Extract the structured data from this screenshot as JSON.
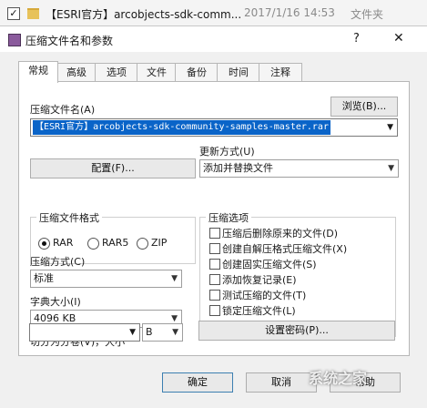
{
  "explorer": {
    "filename": "【ESRI官方】arcobjects-sdk-comm...",
    "date": "2017/1/16 14:53",
    "type": "文件夹"
  },
  "dialog": {
    "title": "压缩文件名和参数",
    "help": "?",
    "close": "✕",
    "tabs": [
      "常规",
      "高级",
      "选项",
      "文件",
      "备份",
      "时间",
      "注释"
    ],
    "archive_label": "压缩文件名(A)",
    "browse": "浏览(B)...",
    "archive_value": "【ESRI官方】arcobjects-sdk-community-samples-master.rar",
    "update_mode_label": "更新方式(U)",
    "profiles": "配置(F)...",
    "update_mode_value": "添加并替换文件",
    "format_group": "压缩文件格式",
    "formats": [
      "RAR",
      "RAR5",
      "ZIP"
    ],
    "options_group": "压缩选项",
    "options": [
      "压缩后删除原来的文件(D)",
      "创建自解压格式压缩文件(X)",
      "创建固实压缩文件(S)",
      "添加恢复记录(E)",
      "测试压缩的文件(T)",
      "锁定压缩文件(L)"
    ],
    "method_label": "压缩方式(C)",
    "method_value": "标准",
    "dict_label": "字典大小(I)",
    "dict_value": "4096 KB",
    "split_label": "切分为分卷(V)，大小",
    "split_unit": "B",
    "set_password": "设置密码(P)...",
    "ok": "确定",
    "cancel": "取消",
    "help_btn": "帮助"
  },
  "watermark": "系统之家"
}
